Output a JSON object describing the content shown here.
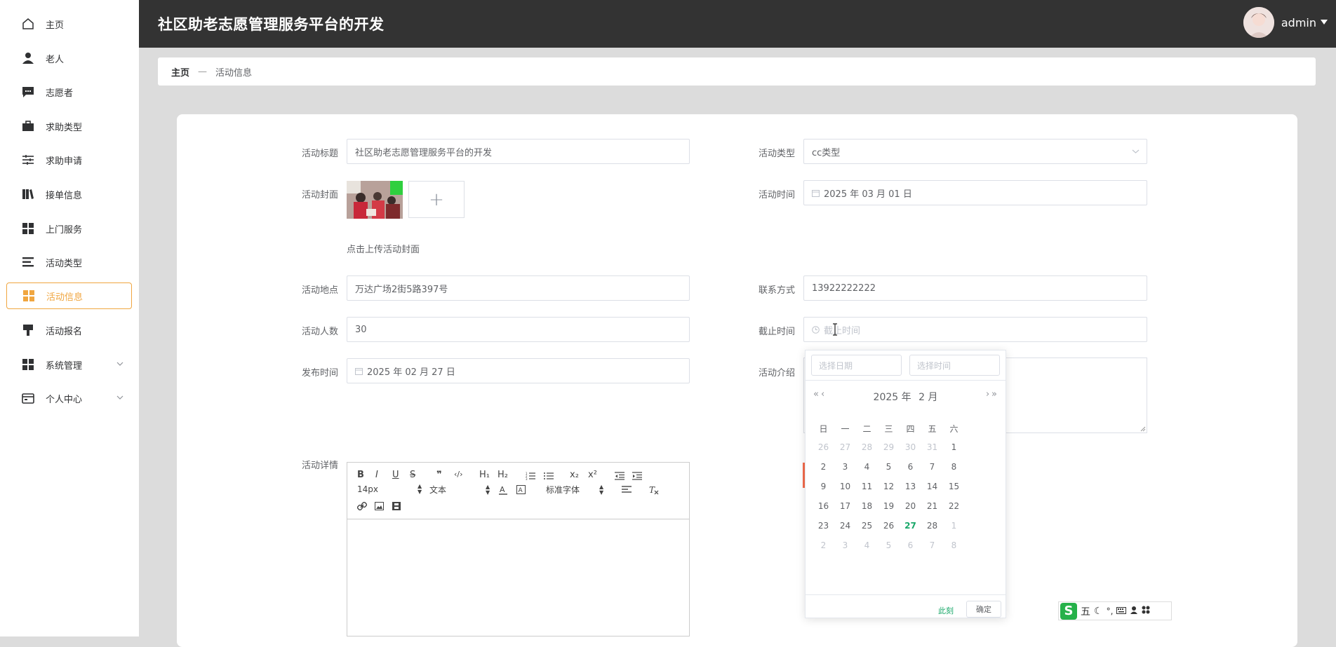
{
  "app": {
    "title": "社区助老志愿管理服务平台的开发",
    "user": "admin"
  },
  "sidebar": {
    "items": [
      {
        "label": "主页",
        "icon": "home-icon"
      },
      {
        "label": "老人",
        "icon": "user-icon"
      },
      {
        "label": "志愿者",
        "icon": "chat-icon"
      },
      {
        "label": "求助类型",
        "icon": "briefcase-icon"
      },
      {
        "label": "求助申请",
        "icon": "sliders-icon"
      },
      {
        "label": "接单信息",
        "icon": "books-icon"
      },
      {
        "label": "上门服务",
        "icon": "grid-icon"
      },
      {
        "label": "活动类型",
        "icon": "list-icon"
      },
      {
        "label": "活动信息",
        "icon": "grid-icon",
        "active": true
      },
      {
        "label": "活动报名",
        "icon": "brush-icon"
      },
      {
        "label": "系统管理",
        "icon": "grid-icon",
        "expandable": true
      },
      {
        "label": "个人中心",
        "icon": "wallet-icon",
        "expandable": true
      }
    ]
  },
  "breadcrumb": {
    "home": "主页",
    "separator": "—",
    "current": "活动信息"
  },
  "form": {
    "title_label": "活动标题",
    "title_value": "社区助老志愿管理服务平台的开发",
    "type_label": "活动类型",
    "type_value": "cc类型",
    "cover_label": "活动封面",
    "cover_hint": "点击上传活动封面",
    "upload_plus": "+",
    "time_label": "活动时间",
    "time_value": "2025 年 03 月 01 日",
    "location_label": "活动地点",
    "location_value": "万达广场2街5路397号",
    "contact_label": "联系方式",
    "contact_value": "13922222222",
    "people_label": "活动人数",
    "people_value": "30",
    "deadline_label": "截止时间",
    "deadline_placeholder": "截止时间",
    "publish_label": "发布时间",
    "publish_value": "2025 年 02 月 27 日",
    "intro_label": "活动介绍",
    "detail_label": "活动详情"
  },
  "editor": {
    "font_size": "14px",
    "block_format": "文本",
    "font_family": "标准字体",
    "buttons": [
      "B",
      "I",
      "U",
      "S",
      "❞",
      "‹/›",
      "H₁",
      "H₂",
      "x₂",
      "x²"
    ]
  },
  "picker": {
    "date_placeholder": "选择日期",
    "time_placeholder": "选择时间",
    "year": "2025 年",
    "month": "2 月",
    "weekdays": [
      "日",
      "一",
      "二",
      "三",
      "四",
      "五",
      "六"
    ],
    "now_label": "此刻",
    "ok_label": "确定",
    "weeks": [
      [
        "26",
        "27",
        "28",
        "29",
        "30",
        "31",
        "1"
      ],
      [
        "2",
        "3",
        "4",
        "5",
        "6",
        "7",
        "8"
      ],
      [
        "9",
        "10",
        "11",
        "12",
        "13",
        "14",
        "15"
      ],
      [
        "16",
        "17",
        "18",
        "19",
        "20",
        "21",
        "22"
      ],
      [
        "23",
        "24",
        "25",
        "26",
        "27",
        "28",
        "1"
      ],
      [
        "2",
        "3",
        "4",
        "5",
        "6",
        "7",
        "8"
      ]
    ],
    "today": "27"
  },
  "ime": {
    "mode": "五"
  },
  "colors": {
    "accent": "#f0a640",
    "header": "#333333",
    "today": "#1aa86a"
  }
}
